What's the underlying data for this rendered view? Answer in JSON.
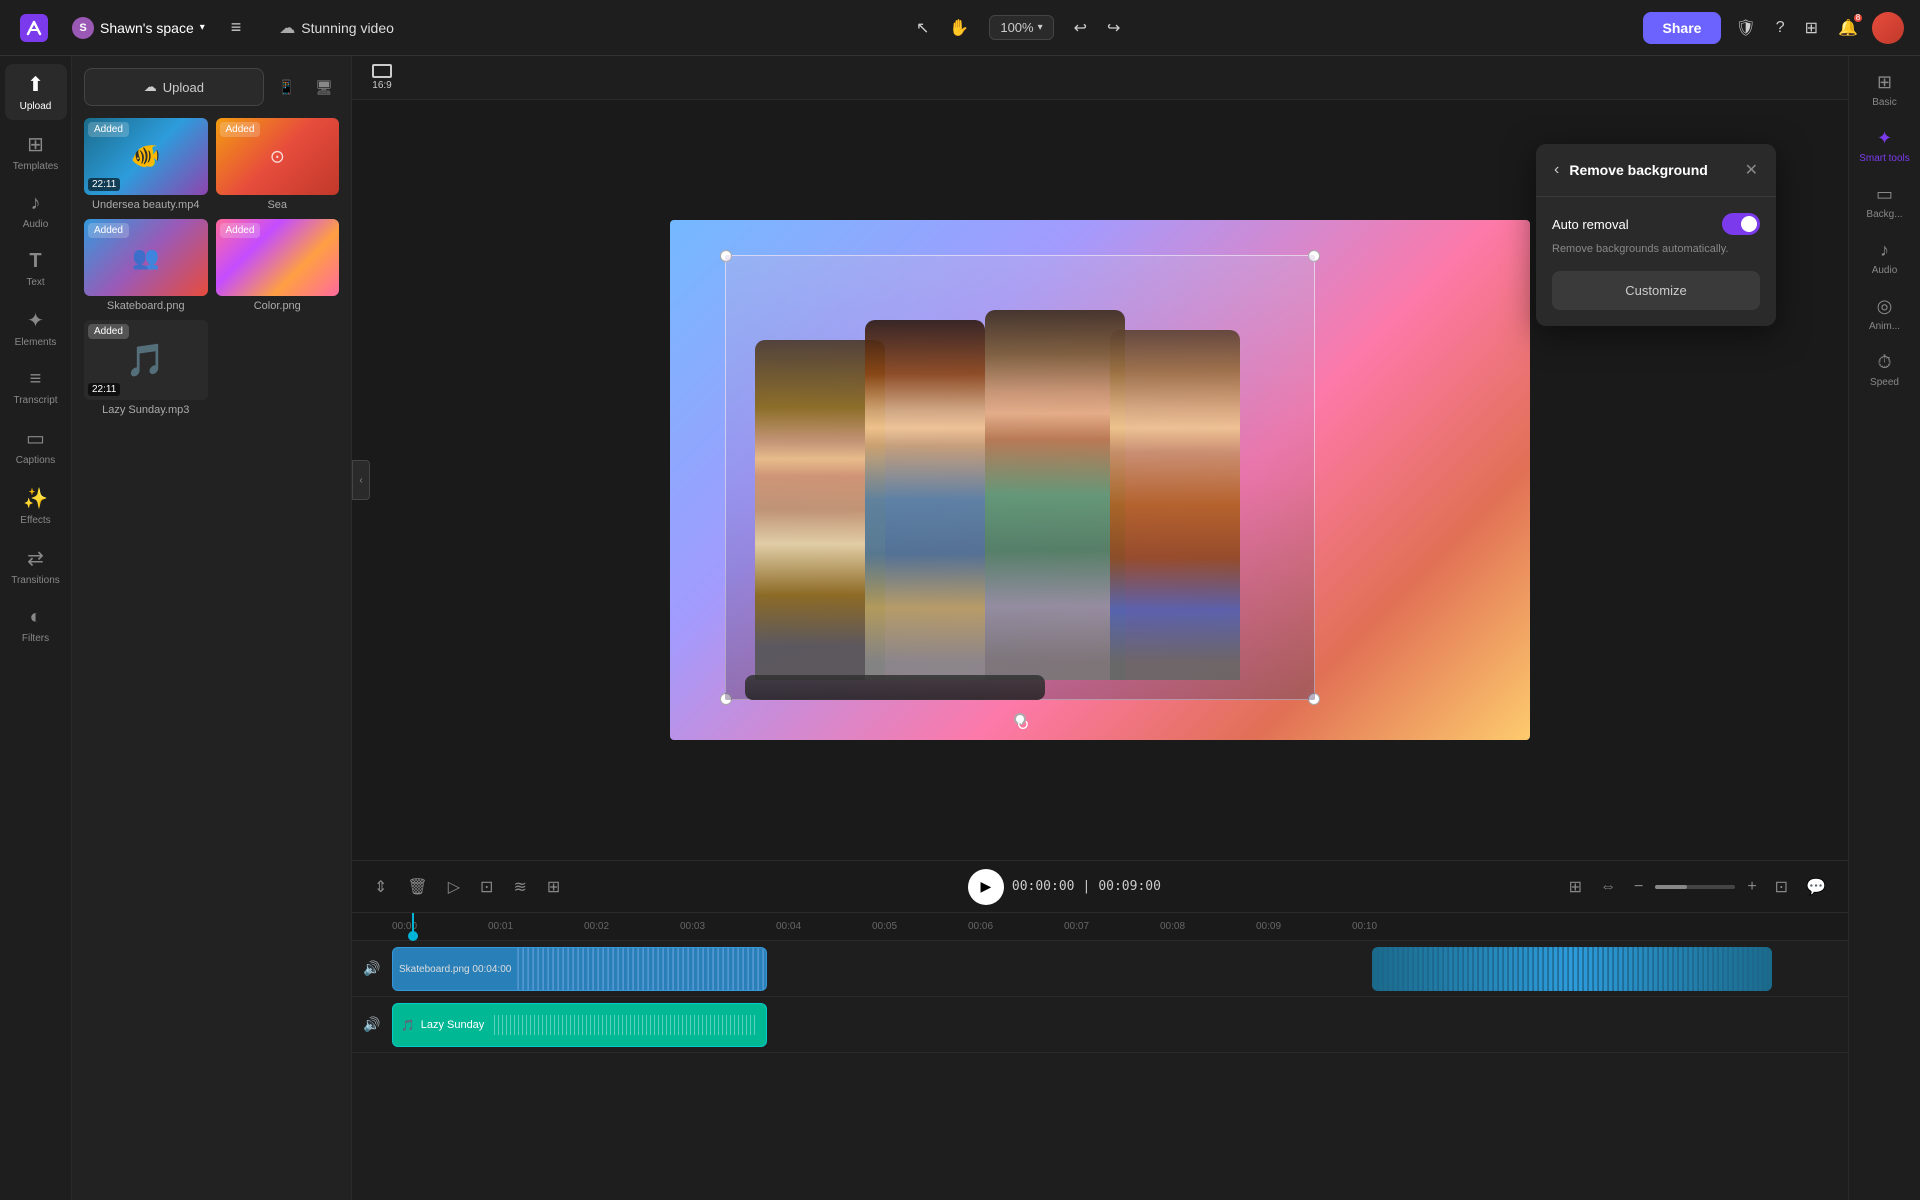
{
  "topbar": {
    "logo_label": "Canva",
    "workspace": "Shawn's space",
    "menu_icon": "≡",
    "project_name": "Stunning video",
    "share_label": "Share",
    "zoom": "100%",
    "undo_icon": "↩",
    "redo_icon": "↪",
    "cursor_icon": "↖",
    "hand_icon": "✋",
    "cloud_icon": "☁",
    "shield_icon": "🛡",
    "help_icon": "?",
    "grid_icon": "⊞",
    "notif_count": "8"
  },
  "sidebar": {
    "items": [
      {
        "id": "upload",
        "icon": "⬆",
        "label": "Upload"
      },
      {
        "id": "templates",
        "icon": "⊞",
        "label": "Templates"
      },
      {
        "id": "audio",
        "icon": "♪",
        "label": "Audio"
      },
      {
        "id": "text",
        "icon": "T",
        "label": "Text"
      },
      {
        "id": "elements",
        "icon": "✦",
        "label": "Elements"
      },
      {
        "id": "transcript",
        "icon": "≡",
        "label": "Transcript"
      },
      {
        "id": "captions",
        "icon": "▭",
        "label": "Captions"
      },
      {
        "id": "effects",
        "icon": "✨",
        "label": "Effects"
      },
      {
        "id": "transitions",
        "icon": "⇄",
        "label": "Transitions"
      },
      {
        "id": "filters",
        "icon": "◐",
        "label": "Filters"
      }
    ]
  },
  "media_panel": {
    "upload_label": "Upload",
    "items": [
      {
        "id": "undersea",
        "type": "video",
        "label": "Undersea beauty.mp4",
        "duration": "22:11",
        "added": true,
        "style": "undersea"
      },
      {
        "id": "sea",
        "type": "image",
        "label": "Sea",
        "added": true,
        "style": "sea"
      },
      {
        "id": "skateboard",
        "type": "image",
        "label": "Skateboard.png",
        "added": true,
        "style": "skateboard"
      },
      {
        "id": "color",
        "type": "image",
        "label": "Color.png",
        "added": true,
        "style": "color"
      },
      {
        "id": "music",
        "type": "audio",
        "label": "Lazy Sunday.mp3",
        "duration": "22:11",
        "added": true,
        "style": "music"
      }
    ],
    "added_label": "Added"
  },
  "canvas": {
    "aspect_ratio": "16:9",
    "aspect_icon": "▭"
  },
  "remove_bg_panel": {
    "title": "Remove background",
    "back_icon": "‹",
    "close_icon": "✕",
    "auto_removal_label": "Auto removal",
    "auto_removal_desc": "Remove backgrounds automatically.",
    "toggle_on": true,
    "customize_label": "Customize"
  },
  "right_panel": {
    "items": [
      {
        "id": "basic",
        "icon": "⊞",
        "label": "Basic"
      },
      {
        "id": "smart_tools",
        "icon": "✦",
        "label": "Smart tools",
        "active": true
      },
      {
        "id": "backg",
        "icon": "▭",
        "label": "Backg..."
      },
      {
        "id": "audio",
        "icon": "♪",
        "label": "Audio"
      },
      {
        "id": "anim",
        "icon": "◎",
        "label": "Anim..."
      },
      {
        "id": "speed",
        "icon": "⏱",
        "label": "Speed"
      }
    ]
  },
  "timeline": {
    "play_icon": "▶",
    "current_time": "00:00:00",
    "separator": "|",
    "total_time": "00:09:00",
    "ruler_marks": [
      "00:00",
      "00:01",
      "00:02",
      "00:03",
      "00:04",
      "00:05",
      "00:06",
      "00:07",
      "00:08",
      "00:09",
      "00:10"
    ],
    "tracks": [
      {
        "id": "video1",
        "clips": [
          {
            "id": "skateboard_clip",
            "label": "Skateboard.png  00:04:00",
            "type": "video"
          },
          {
            "id": "color_clip",
            "type": "color"
          },
          {
            "id": "undersea_clip",
            "type": "undersea"
          }
        ]
      },
      {
        "id": "audio1",
        "clips": [
          {
            "id": "music_clip",
            "label": "🎵 Lazy Sunday",
            "type": "music"
          }
        ]
      }
    ],
    "toolbar_icons": [
      "⇕",
      "🗑",
      "▷",
      "⊡",
      "≋",
      "⊞"
    ],
    "right_icons": [
      "⊞",
      "⇔",
      "−",
      "—",
      "−",
      "⊡",
      "💬"
    ]
  }
}
